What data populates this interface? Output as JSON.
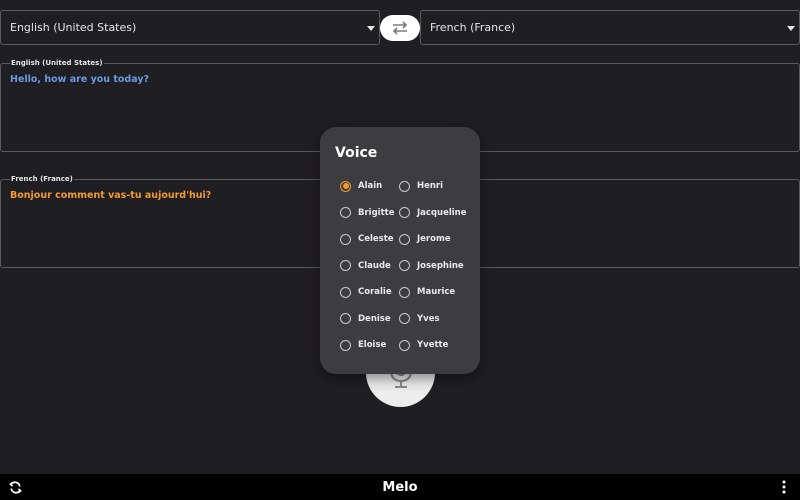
{
  "source_language": "English (United States)",
  "target_language": "French (France)",
  "source_box": {
    "label": "English (United States)",
    "text": "Hello, how are you today?"
  },
  "target_box": {
    "label": "French (France)",
    "text": "Bonjour comment vas-tu aujourd'hui?"
  },
  "voice_dialog": {
    "title": "Voice",
    "selected": "Alain",
    "options": [
      "Alain",
      "Henri",
      "Brigitte",
      "Jacqueline",
      "Celeste",
      "Jerome",
      "Claude",
      "Josephine",
      "Coralie",
      "Maurice",
      "Denise",
      "Yves",
      "Eloise",
      "Yvette"
    ]
  },
  "bottom_bar": {
    "title": "Melo"
  },
  "colors": {
    "accent": "#f39a2e",
    "source_text": "#6b99e3",
    "background": "#1f1e23",
    "dialog": "#3d3c41"
  },
  "icons": {
    "swap": "swap-arrows-icon",
    "mic": "microphone-icon",
    "refresh": "refresh-icon",
    "more": "more-vert-icon"
  }
}
